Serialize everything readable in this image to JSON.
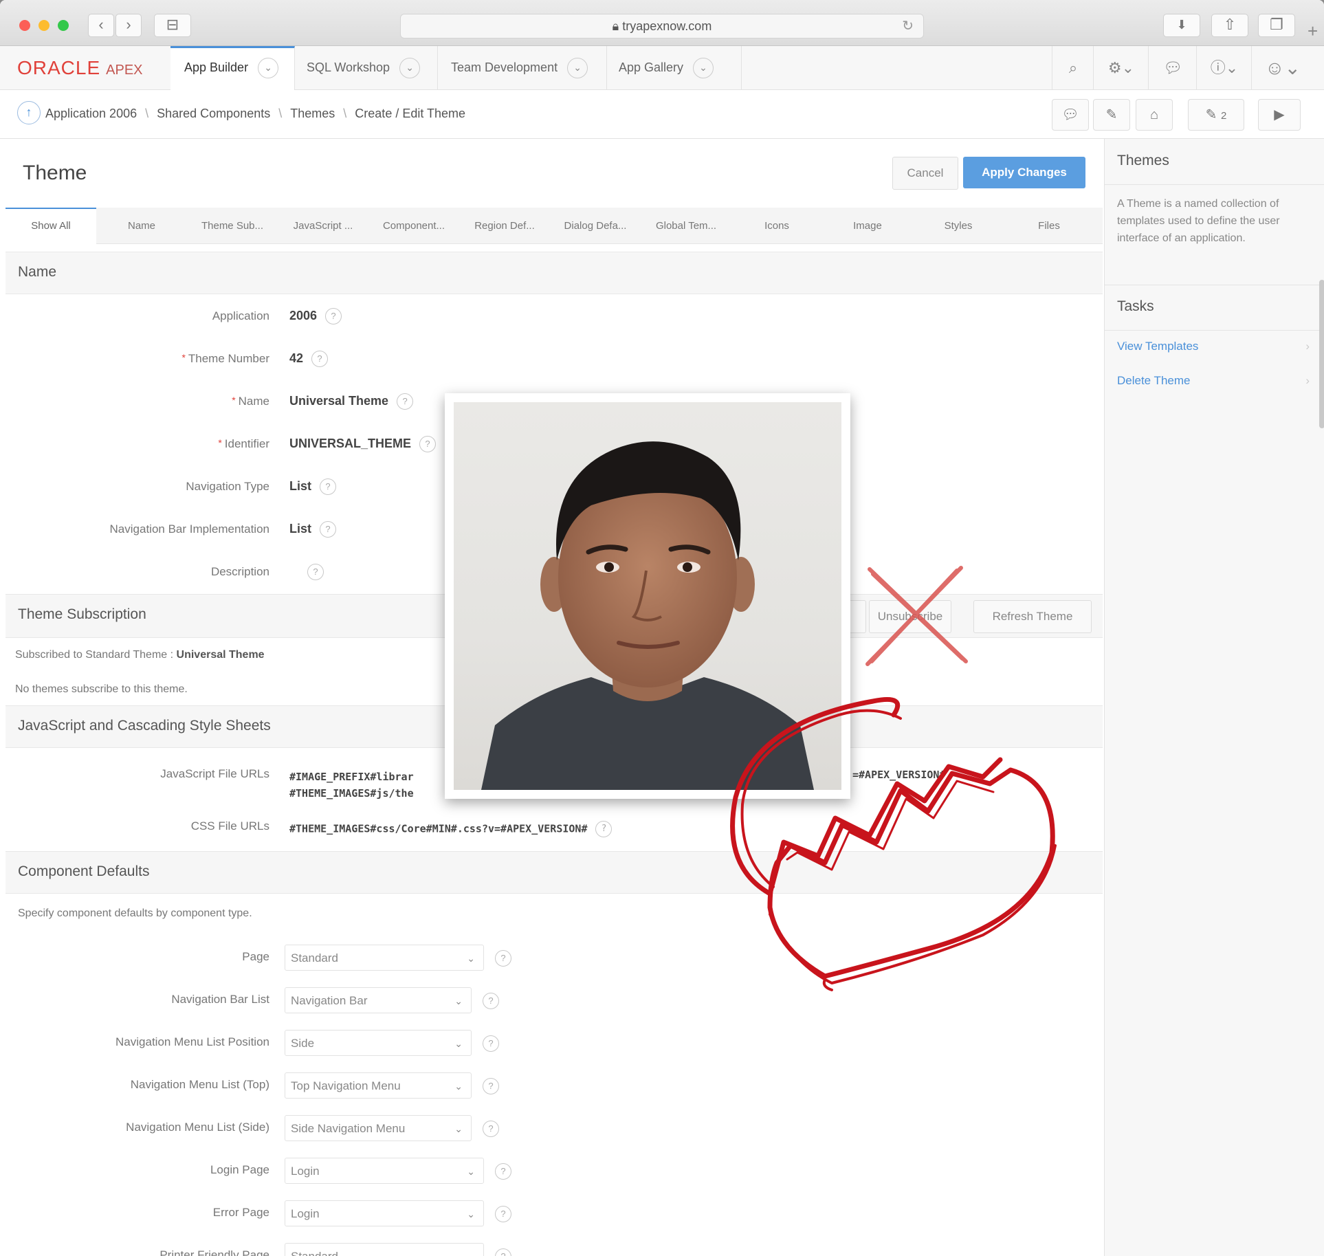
{
  "browser": {
    "url": "tryapexnow.com",
    "back": "‹",
    "forward": "›",
    "sidebar": "⊟"
  },
  "topnav": {
    "logo_oracle": "ORACLE",
    "logo_apex": "APEX",
    "tabs": [
      {
        "label": "App Builder"
      },
      {
        "label": "SQL Workshop"
      },
      {
        "label": "Team Development"
      },
      {
        "label": "App Gallery"
      }
    ]
  },
  "breadcrumb": {
    "items": [
      "Application 2006",
      "Shared Components",
      "Themes",
      "Create / Edit Theme"
    ],
    "badge_count": "2"
  },
  "page": {
    "title": "Theme",
    "cancel_label": "Cancel",
    "apply_label": "Apply Changes",
    "subtabs": [
      "Show All",
      "Name",
      "Theme Sub...",
      "JavaScript ...",
      "Component...",
      "Region Def...",
      "Dialog Defa...",
      "Global Tem...",
      "Icons",
      "Image",
      "Styles",
      "Files"
    ]
  },
  "name_section": {
    "title": "Name",
    "fields": [
      {
        "label": "Application",
        "value": "2006",
        "required": false
      },
      {
        "label": "Theme Number",
        "value": "42",
        "required": true
      },
      {
        "label": "Name",
        "value": "Universal Theme",
        "required": true
      },
      {
        "label": "Identifier",
        "value": "UNIVERSAL_THEME",
        "required": true
      },
      {
        "label": "Navigation Type",
        "value": "List",
        "required": false
      },
      {
        "label": "Navigation Bar Implementation",
        "value": "List",
        "required": false
      },
      {
        "label": "Description",
        "value": "",
        "required": false
      }
    ]
  },
  "subscription": {
    "title": "Theme Subscription",
    "unsubscribe_label": "Unsubscribe",
    "refresh_label": "Refresh Theme",
    "subscribed_prefix": "Subscribed to Standard Theme : ",
    "subscribed_theme": "Universal Theme",
    "no_subscribers": "No themes subscribe to this theme."
  },
  "js_css": {
    "title": "JavaScript and Cascading Style Sheets",
    "js_label": "JavaScript File URLs",
    "js_line1": "#IMAGE_PREFIX#librar",
    "js_line1_tail": "=#APEX_VERSION#",
    "js_line2": "#THEME_IMAGES#js/the",
    "css_label": "CSS File URLs",
    "css_value": "#THEME_IMAGES#css/Core#MIN#.css?v=#APEX_VERSION#"
  },
  "component_defaults": {
    "title": "Component Defaults",
    "description": "Specify component defaults by component type.",
    "fields": [
      {
        "label": "Page",
        "value": "Standard"
      },
      {
        "label": "Navigation Bar List",
        "value": "Navigation Bar"
      },
      {
        "label": "Navigation Menu List Position",
        "value": "Side"
      },
      {
        "label": "Navigation Menu List (Top)",
        "value": "Top Navigation Menu"
      },
      {
        "label": "Navigation Menu List (Side)",
        "value": "Side Navigation Menu"
      },
      {
        "label": "Login Page",
        "value": "Login"
      },
      {
        "label": "Error Page",
        "value": "Login"
      },
      {
        "label": "Printer Friendly Page",
        "value": "Standard"
      }
    ]
  },
  "right_panel": {
    "themes_title": "Themes",
    "themes_text": "A Theme is a named collection of templates used to define the user interface of an application.",
    "tasks_title": "Tasks",
    "tasks": [
      "View Templates",
      "Delete Theme"
    ]
  },
  "help_glyph": "?",
  "colors": {
    "oracle_red": "#e0413a",
    "apex_blue": "#5b9ee0",
    "heart_red": "#c8141c",
    "cross_red": "#d9534f"
  }
}
